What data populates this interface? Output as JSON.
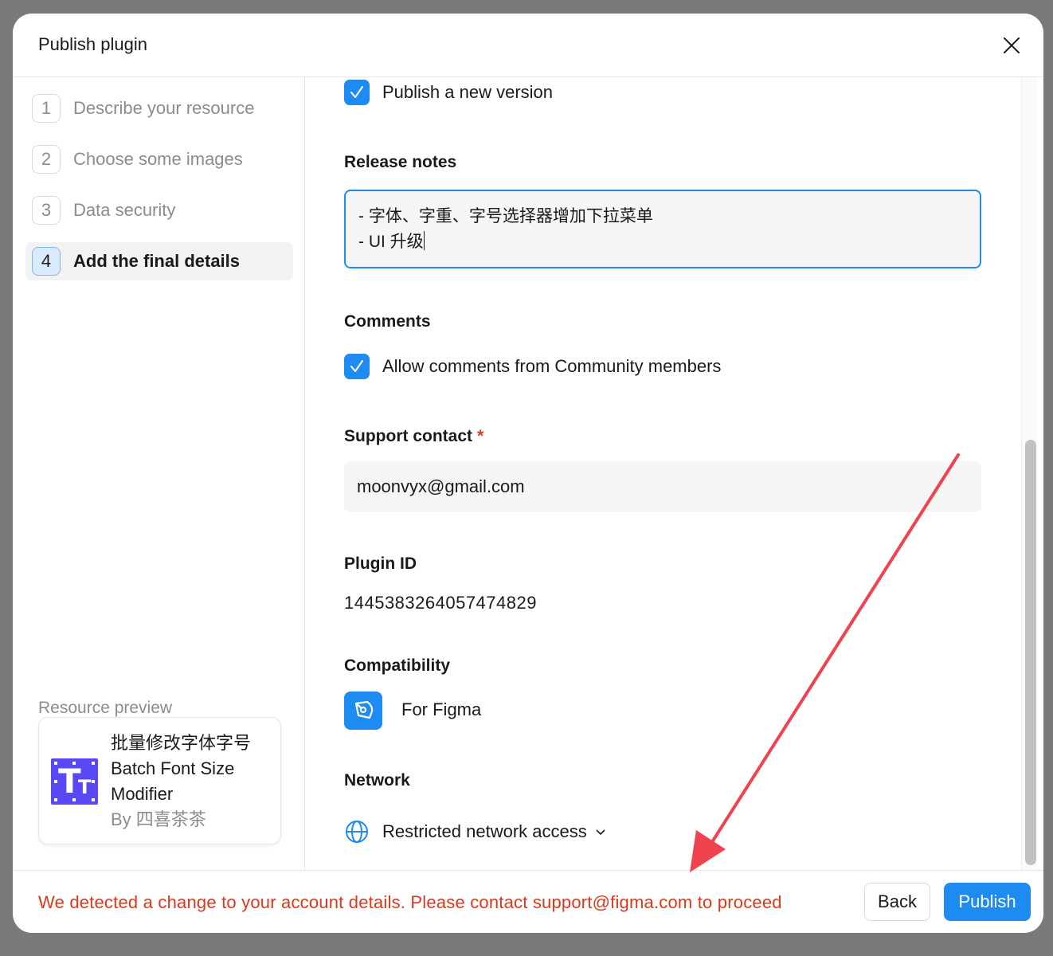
{
  "dialog": {
    "title": "Publish plugin",
    "close_icon": "close-icon"
  },
  "sidebar": {
    "steps": [
      {
        "number": "1",
        "label": "Describe your resource"
      },
      {
        "number": "2",
        "label": "Choose some images"
      },
      {
        "number": "3",
        "label": "Data security"
      },
      {
        "number": "4",
        "label": "Add the final details"
      }
    ],
    "active_step": 4,
    "preview": {
      "heading": "Resource preview",
      "name_cn": "批量修改字体字号",
      "name_en": "Batch Font Size Modifier",
      "author": "By 四喜茶茶",
      "icon_text_big": "T",
      "icon_text_small": "T"
    }
  },
  "form": {
    "publish_new_version": {
      "label": "Publish a new version",
      "checked": true
    },
    "release_notes": {
      "title": "Release notes",
      "value": "- 字体、字重、字号选择器增加下拉菜单\n- UI 升级"
    },
    "comments": {
      "title": "Comments",
      "allow": {
        "label": "Allow comments from Community members",
        "checked": true
      }
    },
    "support_contact": {
      "title": "Support contact",
      "required_mark": "*",
      "value": "moonvyx@gmail.com"
    },
    "plugin_id": {
      "title": "Plugin ID",
      "value": "1445383264057474829"
    },
    "compatibility": {
      "title": "Compatibility",
      "value": "For Figma",
      "icon": "figma-pen-icon"
    },
    "network": {
      "title": "Network",
      "value": "Restricted network access",
      "icon": "globe-icon"
    }
  },
  "footer": {
    "error": "We detected a change to your account details. Please contact support@figma.com to proceed",
    "back_label": "Back",
    "publish_label": "Publish"
  },
  "colors": {
    "accent": "#1d8bf1",
    "error": "#e0361c",
    "annotation_arrow": "#f0434f",
    "plugin_icon": "#5a47f5"
  }
}
